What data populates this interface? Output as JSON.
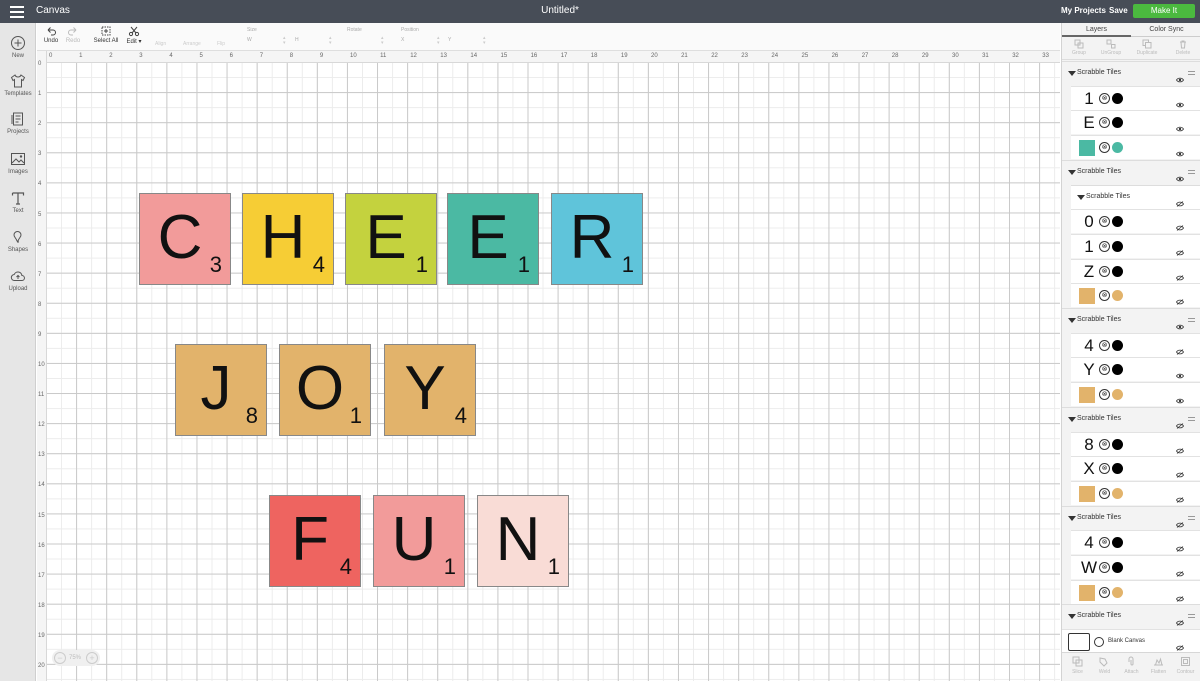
{
  "topbar": {
    "app_title": "Canvas",
    "doc_title": "Untitled*",
    "my_projects": "My Projects",
    "save": "Save",
    "make_it": "Make It",
    "make_it_color": "#4bb93f"
  },
  "leftbar": {
    "items": [
      {
        "label": "New",
        "icon": "plus-circle-icon"
      },
      {
        "label": "Templates",
        "icon": "shirt-icon"
      },
      {
        "label": "Projects",
        "icon": "projects-icon"
      },
      {
        "label": "Images",
        "icon": "image-icon"
      },
      {
        "label": "Text",
        "icon": "text-icon"
      },
      {
        "label": "Shapes",
        "icon": "shapes-icon"
      },
      {
        "label": "Upload",
        "icon": "upload-cloud-icon"
      }
    ]
  },
  "toolbar": {
    "undo": "Undo",
    "redo": "Redo",
    "select_all": "Select All",
    "edit": "Edit",
    "align": "Align",
    "arrange": "Arrange",
    "flip": "Flip",
    "size": "Size",
    "w": "W",
    "h": "H",
    "rotate": "Rotate",
    "position": "Position",
    "x": "X",
    "y": "Y"
  },
  "rulers": {
    "top": [
      "0",
      "1",
      "2",
      "3",
      "4",
      "5",
      "6",
      "7",
      "8",
      "9",
      "10",
      "11",
      "12",
      "13",
      "14",
      "15",
      "16",
      "17",
      "18",
      "19",
      "20",
      "21",
      "22",
      "23",
      "24",
      "25",
      "26",
      "27",
      "28",
      "29",
      "30",
      "31",
      "32",
      "33"
    ],
    "left": [
      "0",
      "1",
      "2",
      "3",
      "4",
      "5",
      "6",
      "7",
      "8",
      "9",
      "10",
      "11",
      "12",
      "13",
      "14",
      "15",
      "16",
      "17",
      "18",
      "19",
      "20"
    ]
  },
  "zoom": {
    "level": "75%",
    "minus": "−",
    "plus": "+"
  },
  "tiles": {
    "cheer": [
      {
        "letter": "C",
        "points": "3",
        "color": "#f29b9a"
      },
      {
        "letter": "H",
        "points": "4",
        "color": "#f6cd35"
      },
      {
        "letter": "E",
        "points": "1",
        "color": "#c4d23e"
      },
      {
        "letter": "E",
        "points": "1",
        "color": "#4bb9a3"
      },
      {
        "letter": "R",
        "points": "1",
        "color": "#5fc4da"
      }
    ],
    "joy": [
      {
        "letter": "J",
        "points": "8",
        "color": "#e2b36b"
      },
      {
        "letter": "O",
        "points": "1",
        "color": "#e2b36b"
      },
      {
        "letter": "Y",
        "points": "4",
        "color": "#e2b36b"
      }
    ],
    "fun": [
      {
        "letter": "F",
        "points": "4",
        "color": "#ee6460"
      },
      {
        "letter": "U",
        "points": "1",
        "color": "#f29b9a"
      },
      {
        "letter": "N",
        "points": "1",
        "color": "#f9dcd6"
      }
    ]
  },
  "panel": {
    "tabs": [
      "Layers",
      "Color Sync"
    ],
    "layer_tools": [
      "Group",
      "UnGroup",
      "Duplicate",
      "Delete"
    ],
    "bottom_tools": [
      "Slice",
      "Weld",
      "Attach",
      "Flatten",
      "Contour"
    ],
    "group_name": "Scrabble Tiles",
    "blank_canvas": "Blank Canvas",
    "layers": [
      {
        "kind": "group",
        "name": "Scrabble Tiles"
      },
      {
        "kind": "text",
        "glyph": "1",
        "dot": "#000000"
      },
      {
        "kind": "text",
        "glyph": "E",
        "dot": "#000000"
      },
      {
        "kind": "shape",
        "swatch": "#4bb9a3",
        "dot": "#4bb9a3"
      },
      {
        "kind": "group",
        "name": "Scrabble Tiles"
      },
      {
        "kind": "subgroup",
        "name": "Scrabble Tiles"
      },
      {
        "kind": "text",
        "glyph": "0",
        "dot": "#000000"
      },
      {
        "kind": "text",
        "glyph": "1",
        "dot": "#000000"
      },
      {
        "kind": "text",
        "glyph": "Z",
        "dot": "#000000"
      },
      {
        "kind": "shape",
        "swatch": "#e2b36b",
        "dot": "#e2b36b"
      },
      {
        "kind": "group",
        "name": "Scrabble Tiles"
      },
      {
        "kind": "text",
        "glyph": "4",
        "dot": "#000000"
      },
      {
        "kind": "text",
        "glyph": "Y",
        "dot": "#000000"
      },
      {
        "kind": "shape",
        "swatch": "#e2b36b",
        "dot": "#e2b36b"
      },
      {
        "kind": "group",
        "name": "Scrabble Tiles"
      },
      {
        "kind": "text",
        "glyph": "8",
        "dot": "#000000"
      },
      {
        "kind": "text",
        "glyph": "X",
        "dot": "#000000"
      },
      {
        "kind": "shape",
        "swatch": "#e2b36b",
        "dot": "#e2b36b"
      },
      {
        "kind": "group",
        "name": "Scrabble Tiles"
      },
      {
        "kind": "text",
        "glyph": "4",
        "dot": "#000000"
      },
      {
        "kind": "text",
        "glyph": "W",
        "dot": "#000000"
      },
      {
        "kind": "shape",
        "swatch": "#e2b36b",
        "dot": "#e2b36b"
      },
      {
        "kind": "group",
        "name": "Scrabble Tiles"
      },
      {
        "kind": "blank",
        "name": "Blank Canvas"
      }
    ]
  }
}
